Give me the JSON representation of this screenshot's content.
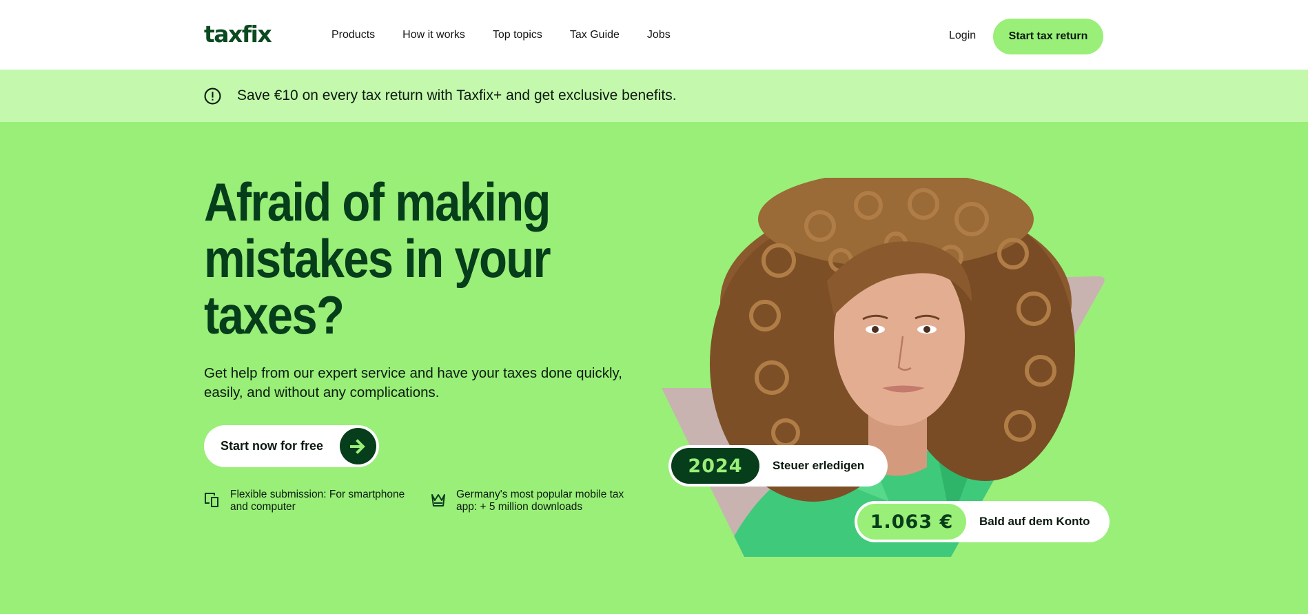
{
  "header": {
    "logo": "taxfix",
    "nav": [
      "Products",
      "How it works",
      "Top topics",
      "Tax Guide",
      "Jobs"
    ],
    "login": "Login",
    "cta": "Start tax return"
  },
  "banner": {
    "icon": "info-circle-icon",
    "text": "Save €10 on every tax return with Taxfix+ and get exclusive benefits."
  },
  "hero": {
    "headline": "Afraid of making mistakes in your taxes?",
    "subheadline": "Get help from our expert service and have your taxes done quickly, easily, and without any complications.",
    "cta": "Start now for free",
    "features": [
      {
        "icon": "devices-icon",
        "text": "Flexible submission: For smartphone and computer"
      },
      {
        "icon": "crown-icon",
        "text": "Germany's most popular mobile tax app: + 5 million downloads"
      }
    ]
  },
  "illustration": {
    "pill_year": {
      "badge": "2024",
      "text": "Steuer erledigen"
    },
    "pill_amount": {
      "badge": "1.063 €",
      "text": "Bald auf dem Konto"
    }
  },
  "colors": {
    "brand_green": "#99ef78",
    "dark_green": "#063d1a",
    "banner_green": "#c4f8ad",
    "shape_mauve": "#c9b3b0"
  }
}
